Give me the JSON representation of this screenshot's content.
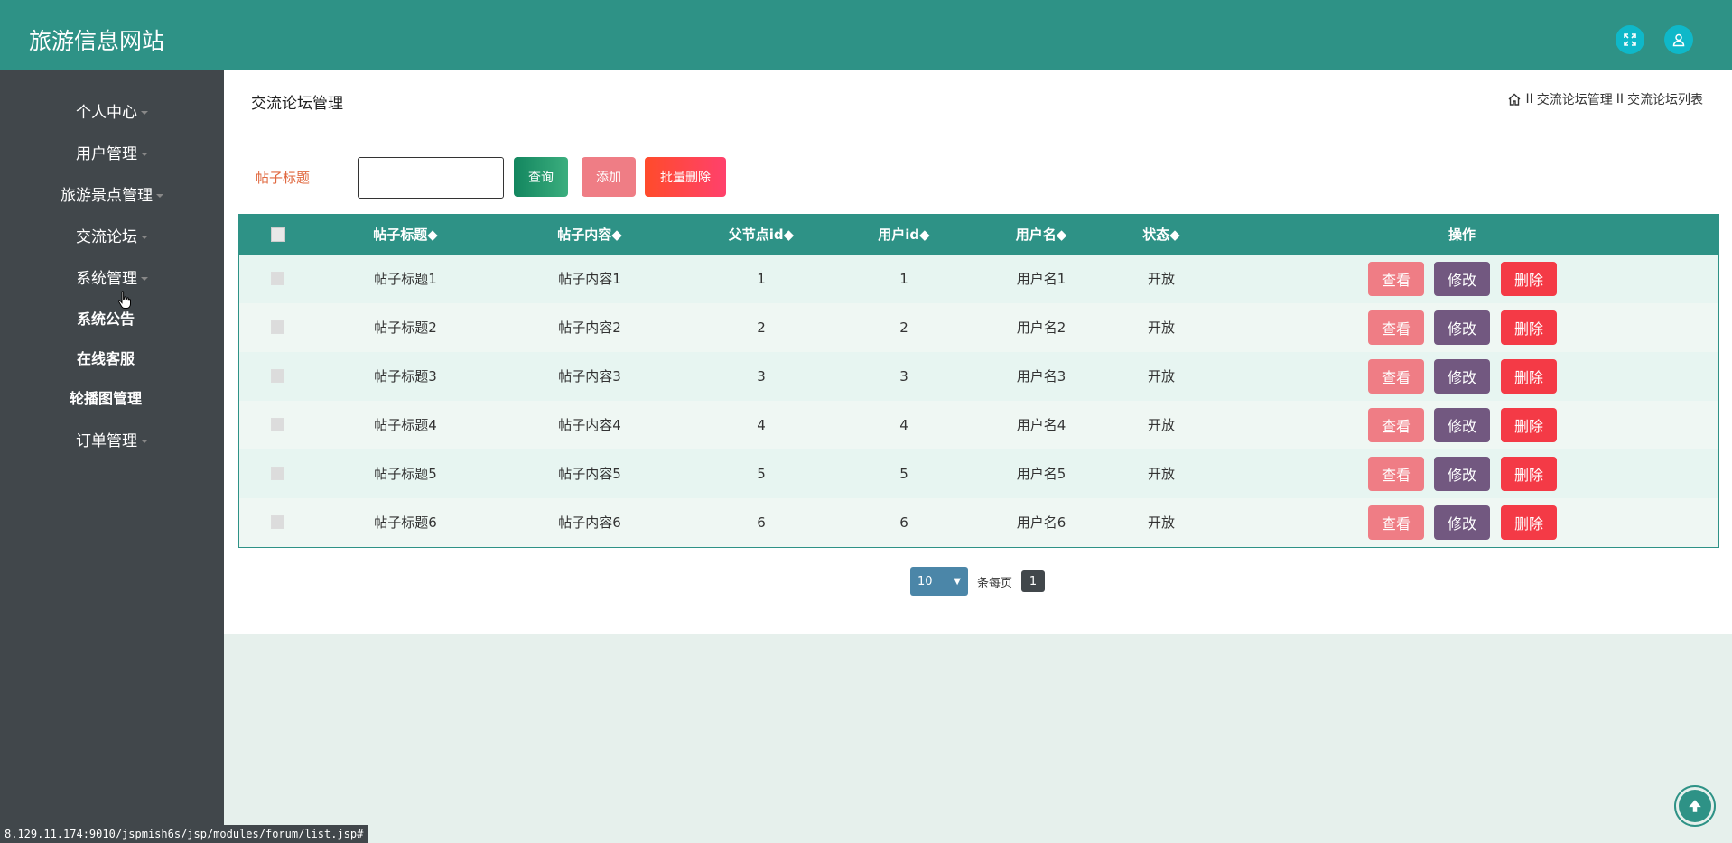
{
  "app": {
    "title": "旅游信息网站"
  },
  "header": {
    "fullscreen_icon": "expand-icon",
    "user_icon": "user-icon"
  },
  "sidebar": {
    "items": [
      {
        "label": "个人中心",
        "caret": true
      },
      {
        "label": "用户管理",
        "caret": true
      },
      {
        "label": "旅游景点管理",
        "caret": true
      },
      {
        "label": "交流论坛",
        "caret": true
      },
      {
        "label": "系统管理",
        "caret": true
      },
      {
        "label": "订单管理",
        "caret": true
      }
    ],
    "sub_items": [
      "系统公告",
      "在线客服",
      "轮播图管理"
    ]
  },
  "page": {
    "title": "交流论坛管理",
    "breadcrumb": [
      "交流论坛管理",
      "交流论坛列表"
    ],
    "breadcrumb_sep": "II"
  },
  "search": {
    "label": "帖子标题",
    "value": "",
    "placeholder": ""
  },
  "toolbar": {
    "query_label": "查询",
    "add_label": "添加",
    "batch_delete_label": "批量删除"
  },
  "table": {
    "headers": [
      "帖子标题◆",
      "帖子内容◆",
      "父节点id◆",
      "用户id◆",
      "用户名◆",
      "状态◆",
      "操作"
    ],
    "rows": [
      [
        "帖子标题1",
        "帖子内容1",
        "1",
        "1",
        "用户名1",
        "开放"
      ],
      [
        "帖子标题2",
        "帖子内容2",
        "2",
        "2",
        "用户名2",
        "开放"
      ],
      [
        "帖子标题3",
        "帖子内容3",
        "3",
        "3",
        "用户名3",
        "开放"
      ],
      [
        "帖子标题4",
        "帖子内容4",
        "4",
        "4",
        "用户名4",
        "开放"
      ],
      [
        "帖子标题5",
        "帖子内容5",
        "5",
        "5",
        "用户名5",
        "开放"
      ],
      [
        "帖子标题6",
        "帖子内容6",
        "6",
        "6",
        "用户名6",
        "开放"
      ]
    ],
    "actions": {
      "view": "查看",
      "edit": "修改",
      "delete": "删除"
    }
  },
  "pagination": {
    "page_size": "10",
    "per_page_label": "条每页",
    "current_page": "1"
  },
  "status_bar": {
    "url": "8.129.11.174:9010/jspmish6s/jsp/modules/forum/list.jsp#"
  },
  "colors": {
    "header": "#2e9286",
    "sidebar": "#41474b",
    "query_button": "#1d8f6a",
    "add_button": "#ef7d85",
    "batch_delete_button": "#f6444a",
    "view_button": "#ef7d85",
    "edit_button": "#725880",
    "delete_button": "#f43a46",
    "search_label": "#e0683f"
  }
}
